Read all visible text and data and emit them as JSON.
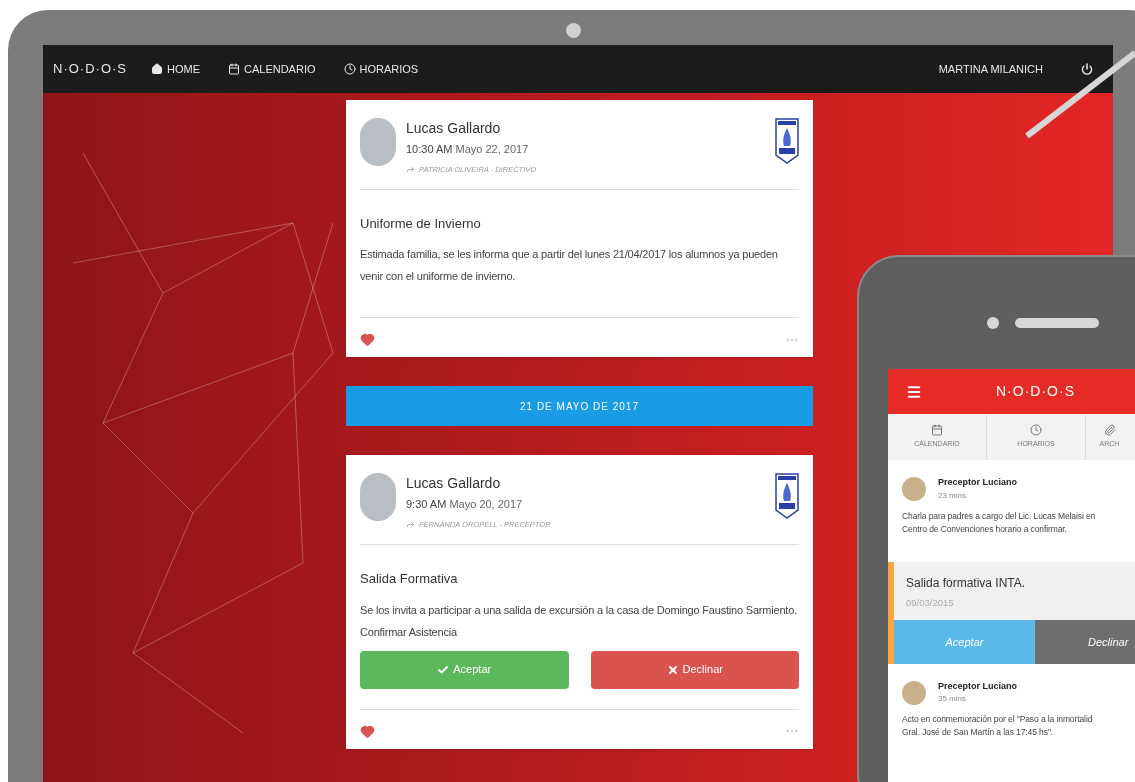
{
  "nav": {
    "logo": "N·O·D·O·S",
    "items": [
      {
        "label": "HOME"
      },
      {
        "label": "CALENDARIO"
      },
      {
        "label": "HORARIOS"
      }
    ],
    "user": "MARTINA MILANICH"
  },
  "feed": [
    {
      "kind": "post",
      "author": "Lucas Gallardo",
      "time": "10:30 AM",
      "date": "Mayo 22, 2017",
      "forwarded_by": "PATRICIA OLIVEIRA - DIRECTIVO",
      "title": "Uniforme de Invierno",
      "body": "Estimada familia, se les informa que a partir del lunes 21/04/2017 los alumnos ya pueden venir con el uniforme de invierno."
    },
    {
      "kind": "date_divider",
      "label": "21 DE MAYO DE 2017"
    },
    {
      "kind": "post",
      "author": "Lucas Gallardo",
      "time": "9:30 AM",
      "date": "Mayo 20, 2017",
      "forwarded_by": "FERNANDA OROPELL - PRECEPTOR",
      "title": "Salida Formativa",
      "body": "Se los invita a participar a una salida de excursión a la casa de Domingo Faustino Sarmiento. Confirmar Asistencia",
      "accept": "Aceptar",
      "decline": "Declinar"
    }
  ],
  "phone": {
    "logo": "N·O·D·O·S",
    "tabs": [
      {
        "label": "CALENDARIO"
      },
      {
        "label": "HORARIOS"
      },
      {
        "label": "ARCH"
      }
    ],
    "feed": [
      {
        "kind": "message",
        "author": "Preceptor Luciano",
        "time": "23 mins",
        "lines": [
          "Charla para padres a cargo del Lic. Lucas Melaisi en",
          "Centro de Convenciones horario a confirmar."
        ]
      },
      {
        "kind": "event",
        "title": "Salida formativa INTA.",
        "date": "09/03/2015",
        "accept": "Aceptar",
        "decline": "Declinar"
      },
      {
        "kind": "message",
        "author": "Preceptor Luciano",
        "time": "35 mins",
        "lines": [
          "Acto en conmemoración por el \"Paso a la inmortalid",
          "Gral. José de San Martín a las 17:45 hs\"."
        ]
      }
    ]
  }
}
